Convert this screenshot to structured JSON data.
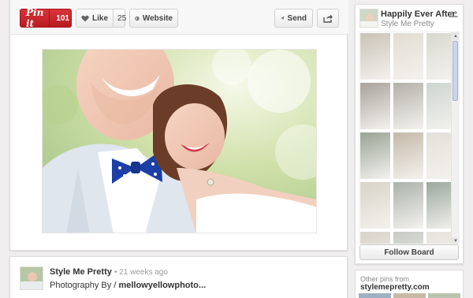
{
  "actions": {
    "pinit_label": "Pin it",
    "pinit_count": "101",
    "like_label": "Like",
    "like_count": "25",
    "website_label": "Website",
    "send_label": "Send"
  },
  "pinner": {
    "name": "Style Me Pretty",
    "time": "• 21 weeks ago",
    "desc_prefix": "Photography By / ",
    "desc_link": "mellowyellowphoto..."
  },
  "board": {
    "title": "Happily Ever After",
    "owner": "Style Me Pretty",
    "follow_label": "Follow Board",
    "tile_colors": [
      "#c9c2b5",
      "#e2dcd2",
      "#d8d8cf",
      "#a7a39b",
      "#b2b1a8",
      "#cdd5d0",
      "#98a394",
      "#c4b8a8",
      "#e4e0d8",
      "#d9d3c7",
      "#aab1ab",
      "#9aa79d",
      "#d8d2c8",
      "#c6cbc2",
      "#e7e4dc"
    ]
  },
  "other_pins": {
    "label": "Other pins from",
    "source": "stylemepretty.com"
  },
  "icons": {
    "like": "heart-icon",
    "website": "globe-icon",
    "send": "send-plane-icon",
    "share": "share-arrow-icon",
    "collaborators": "collaborators-icon",
    "scroll_up": "scroll-up-arrow-icon",
    "scroll_down": "scroll-down-arrow-icon"
  },
  "colors": {
    "pinit_red": "#c9252b",
    "page_bg": "#f0eeee"
  }
}
